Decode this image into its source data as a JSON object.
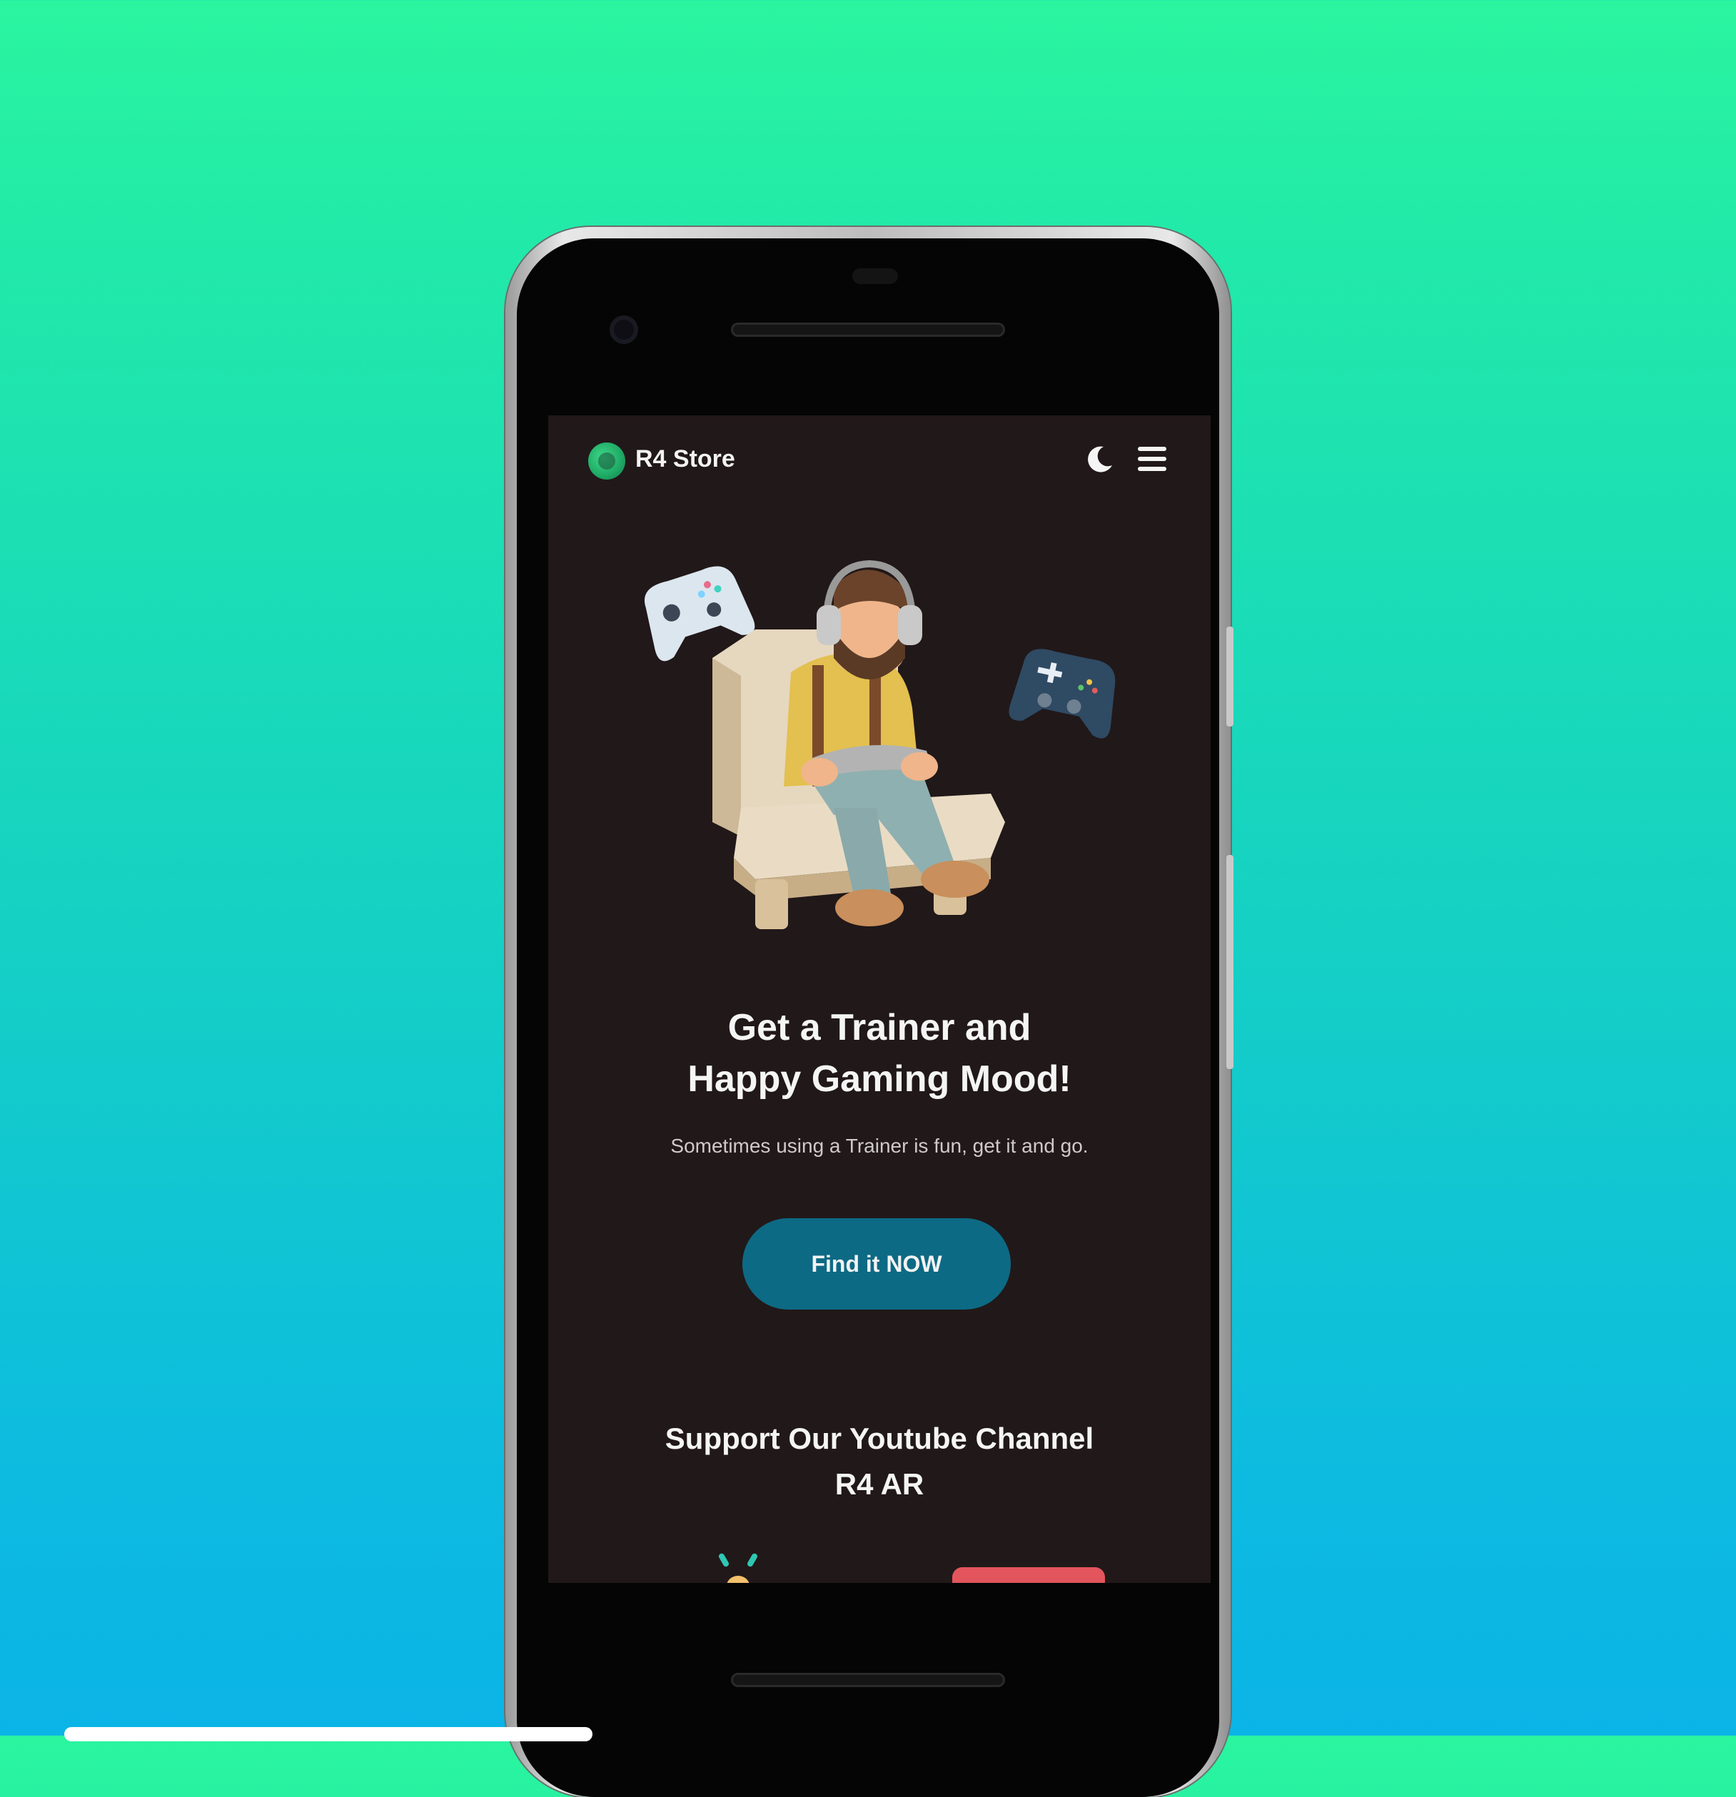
{
  "header": {
    "brand": "R4 Store"
  },
  "hero": {
    "title_line1": "Get a Trainer and",
    "title_line2": "Happy Gaming Mood!",
    "subtitle": "Sometimes using a Trainer is fun, get it and go.",
    "cta_label": "Find it NOW"
  },
  "support": {
    "line1": "Support Our Youtube Channel",
    "line2": "R4 AR"
  },
  "colors": {
    "accent": "#0d6a84",
    "screen_bg": "#211819",
    "red_peek": "#e2555c",
    "logo_green": "#2cc675"
  },
  "icons": [
    "logo-icon",
    "moon-icon",
    "hamburger-menu-icon"
  ]
}
